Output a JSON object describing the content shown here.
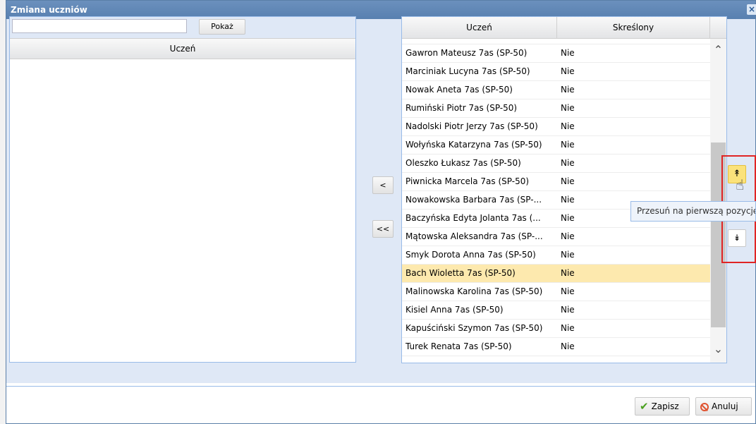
{
  "dialog": {
    "title": "Zmiana uczniów",
    "close_symbol": "×"
  },
  "left_panel": {
    "search_value": "",
    "show_button_label": "Pokaż",
    "column_header": "Uczeń"
  },
  "middle": {
    "move_one_label": "<",
    "move_all_label": "<<"
  },
  "right_panel": {
    "columns": [
      "Uczeń",
      "Skreślony"
    ],
    "rows": [
      {
        "name": "Gawron Mateusz 7as (SP-50)",
        "struck": "Nie"
      },
      {
        "name": "Marciniak Lucyna 7as (SP-50)",
        "struck": "Nie"
      },
      {
        "name": "Nowak Aneta 7as (SP-50)",
        "struck": "Nie"
      },
      {
        "name": "Rumiński Piotr 7as (SP-50)",
        "struck": "Nie"
      },
      {
        "name": "Nadolski Piotr Jerzy 7as (SP-50)",
        "struck": "Nie"
      },
      {
        "name": "Wołyńska Katarzyna 7as (SP-50)",
        "struck": "Nie"
      },
      {
        "name": "Oleszko Łukasz 7as (SP-50)",
        "struck": "Nie"
      },
      {
        "name": "Piwnicka Marcela 7as (SP-50)",
        "struck": "Nie"
      },
      {
        "name": "Nowakowska Barbara 7as (SP-...",
        "struck": "Nie"
      },
      {
        "name": "Baczyńska Edyta Jolanta 7as (...",
        "struck": "Nie"
      },
      {
        "name": "Mątowska Aleksandra 7as (SP-...",
        "struck": "Nie"
      },
      {
        "name": "Smyk Dorota Anna 7as (SP-50)",
        "struck": "Nie"
      },
      {
        "name": "Bach Wioletta 7as (SP-50)",
        "struck": "Nie",
        "selected": true
      },
      {
        "name": "Malinowska Karolina 7as (SP-50)",
        "struck": "Nie"
      },
      {
        "name": "Kisiel Anna 7as (SP-50)",
        "struck": "Nie"
      },
      {
        "name": "Kapuściński Szymon 7as (SP-50)",
        "struck": "Nie"
      },
      {
        "name": "Turek Renata 7as (SP-50)",
        "struck": "Nie"
      }
    ]
  },
  "side_tools": {
    "move_top_icon": "double-arrow-up-icon",
    "move_bottom_icon": "double-arrow-down-icon",
    "tooltip": "Przesuń na pierwszą pozycję"
  },
  "footer": {
    "save_label": "Zapisz",
    "cancel_label": "Anuluj"
  },
  "colors": {
    "titlebar": "#5880b0",
    "selected_row": "#fde9ae",
    "highlight_border": "#e02424",
    "move_button": "#fbe27a"
  }
}
